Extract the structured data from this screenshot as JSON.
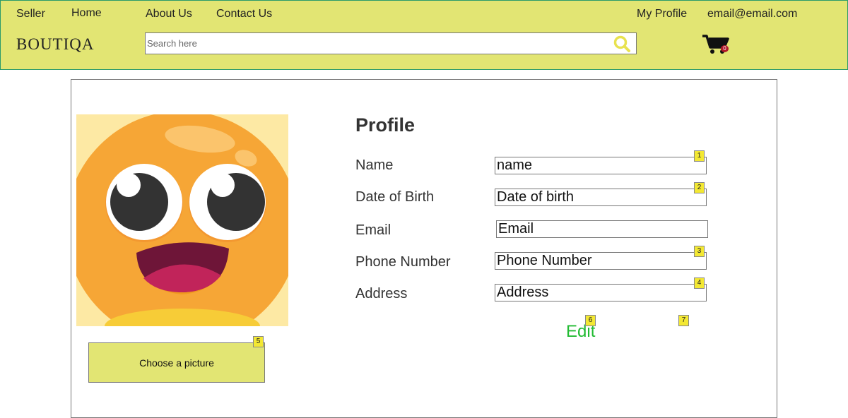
{
  "header": {
    "nav": {
      "seller": "Seller",
      "home": "Home",
      "about": "About Us",
      "contact": "Contact Us",
      "my_profile": "My Profile",
      "email": "email@email.com"
    },
    "logo": "BOUTIQA",
    "search": {
      "placeholder": "Search here",
      "value": ""
    },
    "cart": {
      "count": "0"
    },
    "colors": {
      "bar": "#e2e573",
      "search_icon": "#e8e24f"
    }
  },
  "avatar": {
    "icon": "happy-face-emoji",
    "button_label": "Choose a picture"
  },
  "profile": {
    "title": "Profile",
    "fields": [
      {
        "label": "Name",
        "value": "name"
      },
      {
        "label": "Date of Birth",
        "value": "Date of birth"
      },
      {
        "label": "Email",
        "value": "Email"
      },
      {
        "label": "Phone Number",
        "value": "Phone Number"
      },
      {
        "label": "Address",
        "value": "Address"
      }
    ],
    "edit_label": "Edit",
    "edit_color": "#22bb33"
  },
  "tags": [
    "1",
    "2",
    "3",
    "4",
    "5",
    "6",
    "7"
  ]
}
